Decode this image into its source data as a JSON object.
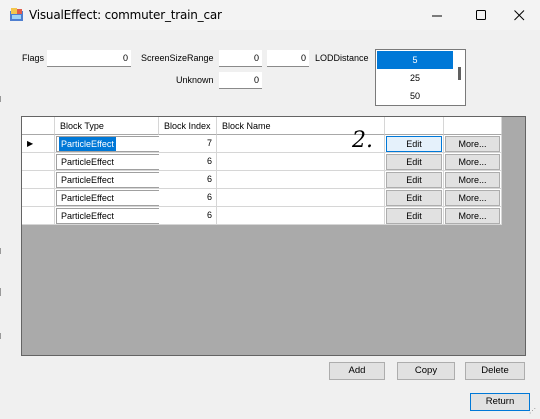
{
  "window": {
    "title": "VisualEffect: commuter_train_car",
    "minimize_icon": "minimize-icon",
    "maximize_icon": "maximize-icon",
    "close_icon": "close-icon",
    "app_icon": "visual-effect-app-icon"
  },
  "fields": {
    "flags_label": "Flags",
    "flags_value": "0",
    "screen_size_range_label": "ScreenSizeRange",
    "screen_size_range_min": "0",
    "screen_size_range_max": "0",
    "unknown_label": "Unknown",
    "unknown_value": "0",
    "lod_label": "LODDistance"
  },
  "lod_distance": {
    "items": [
      "5",
      "25",
      "50"
    ],
    "selected_index": 0
  },
  "grid": {
    "columns": [
      "Block Type",
      "Block Index",
      "Block Name",
      "",
      ""
    ],
    "rows": [
      {
        "type": "ParticleEffect",
        "index": "7",
        "name": "",
        "edit": "Edit",
        "more": "More..."
      },
      {
        "type": "ParticleEffect",
        "index": "6",
        "name": "",
        "edit": "Edit",
        "more": "More..."
      },
      {
        "type": "ParticleEffect",
        "index": "6",
        "name": "",
        "edit": "Edit",
        "more": "More..."
      },
      {
        "type": "ParticleEffect",
        "index": "6",
        "name": "",
        "edit": "Edit",
        "more": "More..."
      },
      {
        "type": "ParticleEffect",
        "index": "6",
        "name": "",
        "edit": "Edit",
        "more": "More..."
      }
    ],
    "current_row_marker": "▶",
    "dropdown_glyph": "▼"
  },
  "buttons": {
    "add": "Add",
    "copy": "Copy",
    "delete": "Delete",
    "return": "Return"
  },
  "annotation": "2.",
  "colors": {
    "selection": "#0078d7",
    "grid_background": "#aaaaaa",
    "window_background": "#f0f0f0"
  }
}
